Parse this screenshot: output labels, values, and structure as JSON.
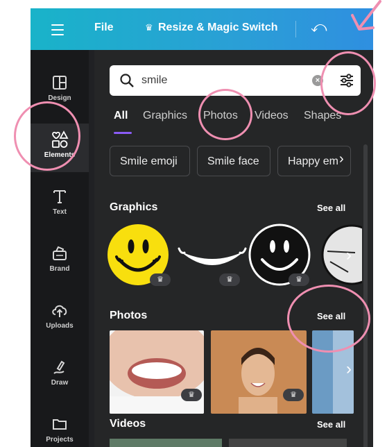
{
  "topbar": {
    "file_label": "File",
    "resize_label": "Resize & Magic Switch"
  },
  "rail": {
    "items": [
      {
        "label": "Design"
      },
      {
        "label": "Elements"
      },
      {
        "label": "Text"
      },
      {
        "label": "Brand"
      },
      {
        "label": "Uploads"
      },
      {
        "label": "Draw"
      },
      {
        "label": "Projects"
      }
    ],
    "active_index": 1
  },
  "search": {
    "value": "smile"
  },
  "tabs": [
    "All",
    "Graphics",
    "Photos",
    "Videos",
    "Shapes"
  ],
  "active_tab": "All",
  "suggestions": [
    "Smile emoji",
    "Smile face",
    "Happy em"
  ],
  "sections": {
    "graphics": {
      "title": "Graphics",
      "see_all": "See all"
    },
    "photos": {
      "title": "Photos",
      "see_all": "See all"
    },
    "videos": {
      "title": "Videos",
      "see_all": "See all"
    }
  },
  "colors": {
    "topbar_start": "#19b3c9",
    "topbar_end": "#2f8fe0",
    "panel_bg": "#252627",
    "rail_bg": "#18191b",
    "tab_accent": "#8b5cf6",
    "annotation_pink": "#ef8fb1"
  }
}
